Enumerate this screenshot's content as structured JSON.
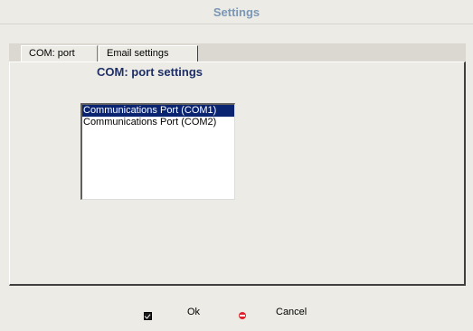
{
  "window": {
    "title": "Settings"
  },
  "tabs": [
    {
      "label": "COM: port",
      "active": true
    },
    {
      "label": "Email settings",
      "active": false
    }
  ],
  "panel": {
    "title": "COM: port settings",
    "ports": [
      {
        "label": "Communications Port (COM1)",
        "selected": true
      },
      {
        "label": "Communications Port (COM2)",
        "selected": false
      }
    ]
  },
  "footer": {
    "ok_label": "Ok",
    "ok_icon": "check-icon",
    "cancel_label": "Cancel",
    "cancel_icon": "stop-icon"
  },
  "colors": {
    "title": "#7a97b5",
    "section_title": "#1f2f66",
    "selection": "#0a2472",
    "cancel_icon": "#e0212b"
  }
}
